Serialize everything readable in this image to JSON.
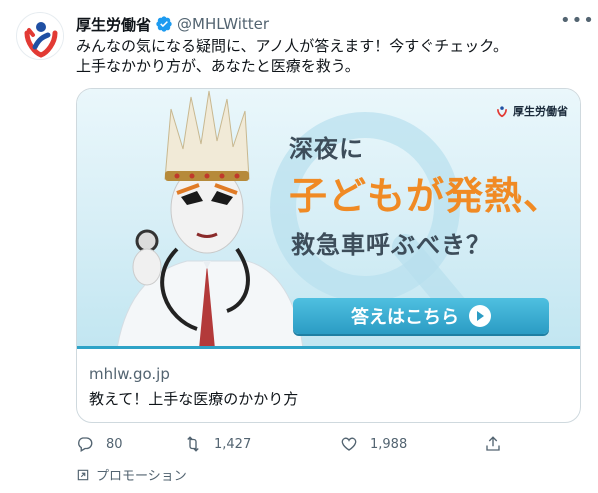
{
  "tweet": {
    "display_name": "厚生労働省",
    "handle": "@MHLWitter",
    "text": "みんなの気になる疑問に、アノ人が答えます！今すぐチェック。\n上手なかかり方が、あなたと医療を救う。"
  },
  "card": {
    "logo_text": "厚生労働省",
    "headline_line1": "深夜に",
    "headline_line2": "子どもが発熱、",
    "headline_line3": "救急車呼ぶべき？",
    "cta_label": "答えはこちら",
    "domain": "mhlw.go.jp",
    "title": "教えて！上手な医療のかかり方"
  },
  "actions": {
    "reply_count": "80",
    "retweet_count": "1,427",
    "like_count": "1,988"
  },
  "promoted_label": "プロモーション",
  "colors": {
    "accent_orange": "#f08a24",
    "cta_blue": "#2b9cc4",
    "muted_text": "#536471",
    "verified_blue": "#1d9bf0"
  },
  "icons": [
    "more-icon",
    "verified-badge-icon",
    "reply-icon",
    "retweet-icon",
    "like-icon",
    "share-icon",
    "promoted-icon",
    "play-arrow-icon"
  ]
}
